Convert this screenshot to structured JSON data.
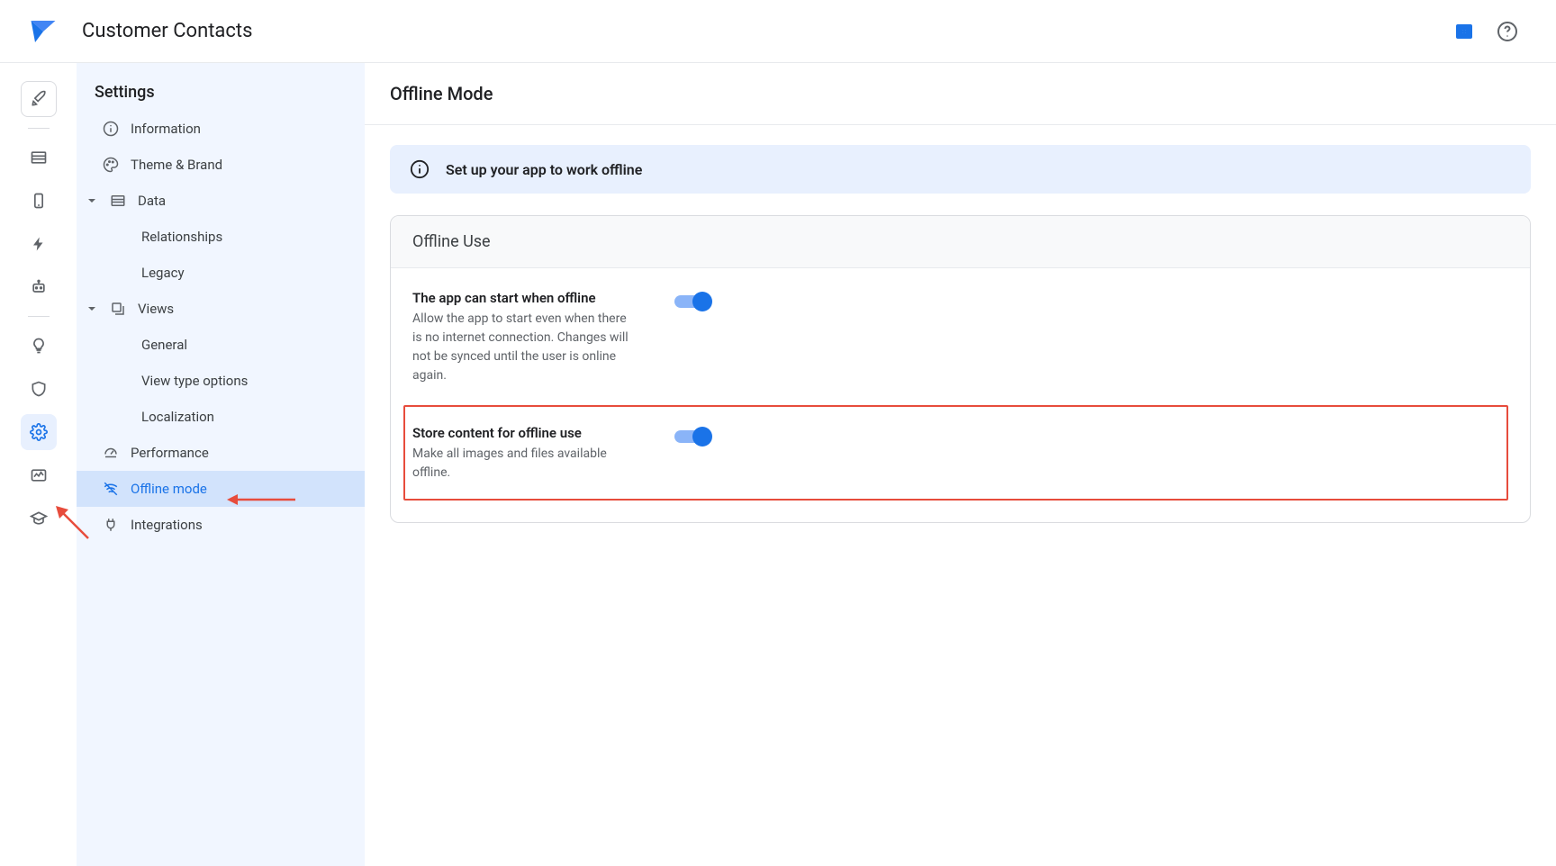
{
  "header": {
    "app_title": "Customer Contacts"
  },
  "sidebar": {
    "title": "Settings",
    "information": "Information",
    "theme_brand": "Theme & Brand",
    "data": "Data",
    "data_children": {
      "relationships": "Relationships",
      "legacy": "Legacy"
    },
    "views": "Views",
    "views_children": {
      "general": "General",
      "view_type_options": "View type options",
      "localization": "Localization"
    },
    "performance": "Performance",
    "offline_mode": "Offline mode",
    "integrations": "Integrations"
  },
  "content": {
    "page_title": "Offline Mode",
    "banner": "Set up your app to work offline",
    "panel_title": "Offline Use",
    "settings": [
      {
        "title": "The app can start when offline",
        "desc": "Allow the app to start even when there is no internet connection. Changes will not be synced until the user is online again.",
        "enabled": true
      },
      {
        "title": "Store content for offline use",
        "desc": "Make all images and files available offline.",
        "enabled": true
      }
    ]
  }
}
